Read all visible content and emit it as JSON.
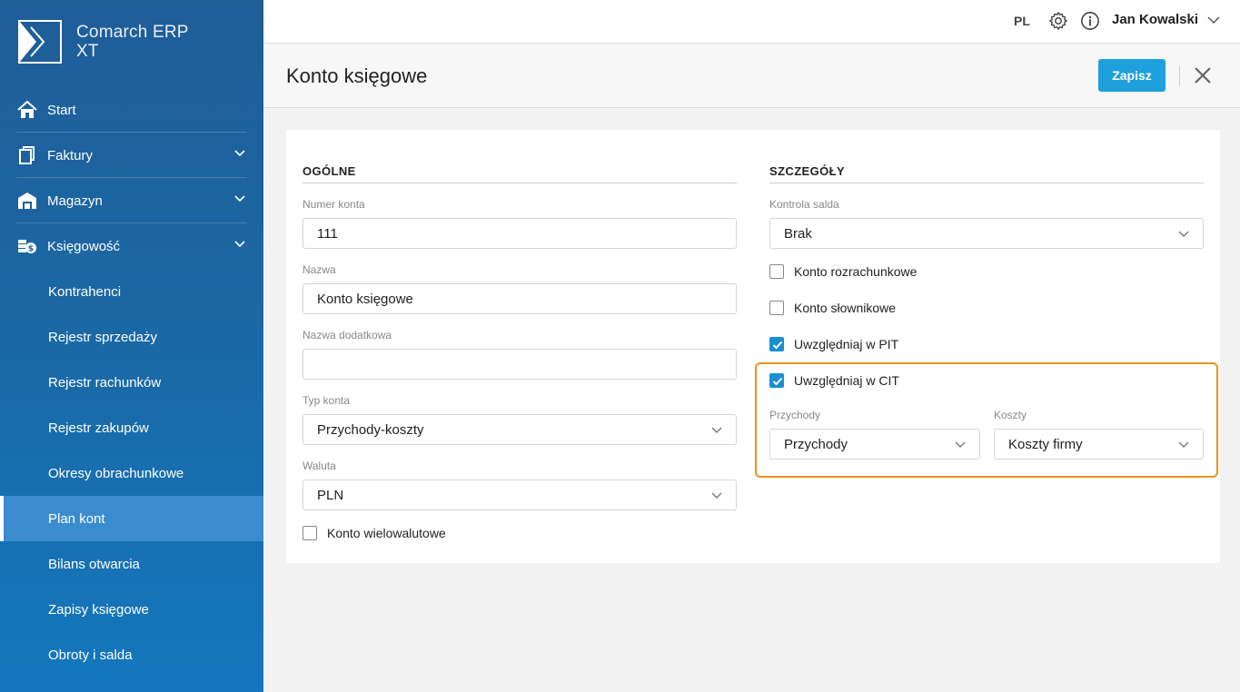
{
  "brand": {
    "line1": "Comarch ERP",
    "line2": "XT"
  },
  "nav": {
    "items": [
      {
        "label": "Start",
        "icon": "home-icon"
      },
      {
        "label": "Faktury",
        "icon": "invoices-icon"
      },
      {
        "label": "Magazyn",
        "icon": "warehouse-icon"
      },
      {
        "label": "Księgowość",
        "icon": "accounting-icon"
      }
    ],
    "subitems": [
      "Kontrahenci",
      "Rejestr sprzedaży",
      "Rejestr rachunków",
      "Rejestr zakupów",
      "Okresy obrachunkowe",
      "Plan kont",
      "Bilans otwarcia",
      "Zapisy księgowe",
      "Obroty i salda"
    ],
    "active": "Plan kont"
  },
  "topbar": {
    "lang": "PL",
    "user": "Jan Kowalski"
  },
  "page": {
    "title": "Konto księgowe",
    "save_label": "Zapisz"
  },
  "general": {
    "title": "OGÓLNE",
    "account_number": {
      "label": "Numer konta",
      "value": "111"
    },
    "name": {
      "label": "Nazwa",
      "value": "Konto księgowe"
    },
    "extra_name": {
      "label": "Nazwa dodatkowa",
      "value": ""
    },
    "account_type": {
      "label": "Typ konta",
      "value": "Przychody-koszty"
    },
    "currency": {
      "label": "Waluta",
      "value": "PLN"
    },
    "multicurrency": {
      "label": "Konto wielowalutowe",
      "checked": false
    }
  },
  "details": {
    "title": "SZCZEGÓŁY",
    "balance_control": {
      "label": "Kontrola salda",
      "value": "Brak"
    },
    "settlement": {
      "label": "Konto rozrachunkowe",
      "checked": false
    },
    "dictionary": {
      "label": "Konto słownikowe",
      "checked": false
    },
    "pit": {
      "label": "Uwzględniaj w PIT",
      "checked": true
    },
    "cit": {
      "label": "Uwzględniaj w CIT",
      "checked": true
    },
    "revenue": {
      "label": "Przychody",
      "value": "Przychody"
    },
    "costs": {
      "label": "Koszty",
      "value": "Koszty firmy"
    }
  },
  "colors": {
    "accent": "#1ea0dc",
    "highlight": "#f0901c",
    "sidebar": "#1a6aa8"
  }
}
